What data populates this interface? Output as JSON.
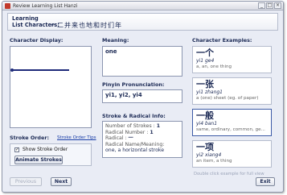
{
  "window": {
    "title": "Review Learning List Hanzi",
    "btn_min": "_",
    "btn_max": "□",
    "btn_close": "×"
  },
  "header": {
    "label_line1": "Learning",
    "label_line2": "List Characters:",
    "characters": "一二并来也地和时们年"
  },
  "sections": {
    "char_display": "Character Display:",
    "meaning": "Meaning:",
    "pinyin": "Pinyin Pronunciation:",
    "stroke_radical": "Stroke & Radical Info:",
    "examples": "Character Examples:",
    "stroke_order": "Stroke Order:",
    "stroke_order_tips": "Stroke Order Tips"
  },
  "stroke_progress": 0.75,
  "stroke_order": {
    "show_label": "Show Stroke Order",
    "show_checked": true,
    "check_mark": "✓",
    "animate_button": "Animate Strokes"
  },
  "meaning": {
    "value": "one"
  },
  "pinyin": {
    "value": "yi1, yi2, yi4"
  },
  "info": {
    "strokes_label": "Number of Strokes :",
    "strokes_value": "1",
    "radical_number_label": "Radical Number :",
    "radical_number_value": "1",
    "radical_label": "Radical :",
    "radical_value": "一",
    "radical_name_label": "Radical Name/Meaning:",
    "radical_name_value": "one, a horizontal stroke"
  },
  "examples": [
    {
      "word": "一个",
      "pinyin": "yi1 ge4",
      "definition": "a, an, one thing"
    },
    {
      "word": "一张",
      "pinyin": "yi1 zhang1",
      "definition": "a (one) sheet (eg. of paper)"
    },
    {
      "word": "一般",
      "pinyin": "yi4 ban1",
      "definition": "same, ordinary, common, ge..."
    },
    {
      "word": "一项",
      "pinyin": "yi2 xiang4",
      "definition": "an item, a thing"
    }
  ],
  "examples_hint": "Double click example for full view",
  "buttons": {
    "previous": "Previous",
    "next": "Next",
    "exit": "Exit"
  }
}
